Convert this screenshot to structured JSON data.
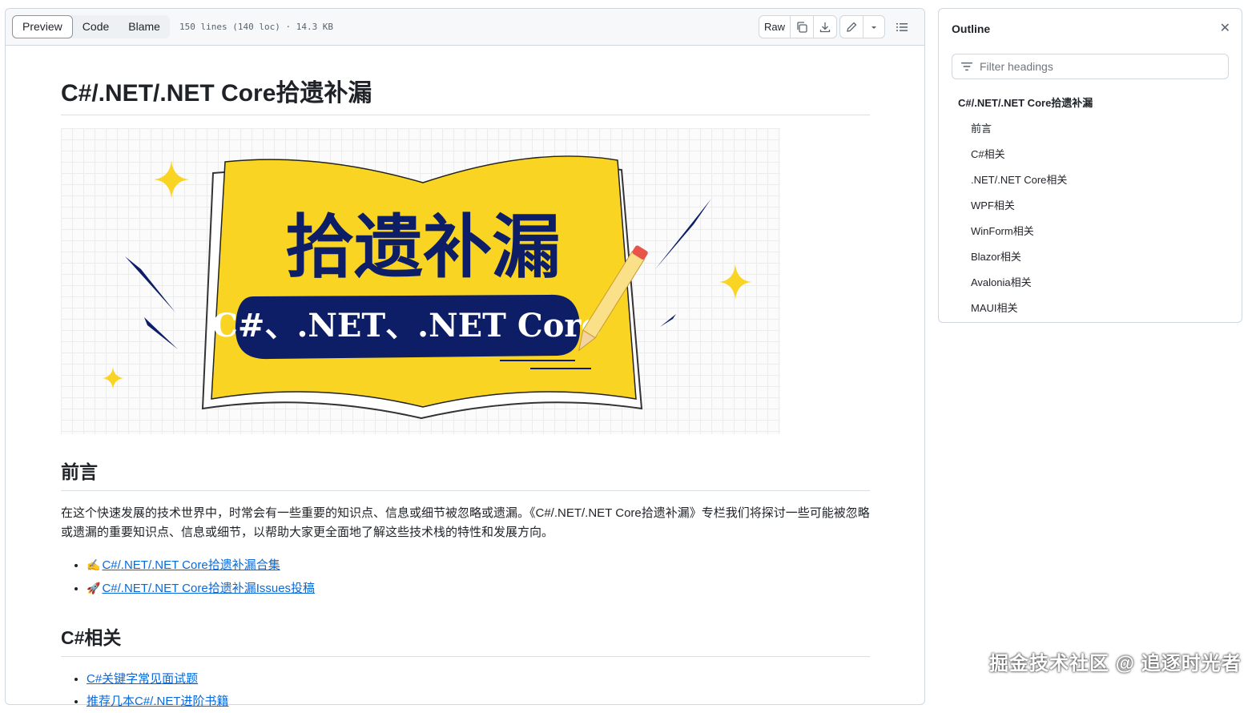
{
  "toolbar": {
    "tabs": [
      "Preview",
      "Code",
      "Blame"
    ],
    "file_info": "150 lines (140 loc) · 14.3 KB",
    "raw_label": "Raw"
  },
  "article": {
    "title": "C#/.NET/.NET Core拾遗补漏",
    "banner": {
      "main_text": "拾遗补漏",
      "sub_text": "C#、.NET、.NET Core"
    },
    "sections": [
      {
        "heading": "前言",
        "paragraph": "在这个快速发展的技术世界中，时常会有一些重要的知识点、信息或细节被忽略或遗漏。《C#/.NET/.NET Core拾遗补漏》专栏我们将探讨一些可能被忽略或遗漏的重要知识点、信息或细节，以帮助大家更全面地了解这些技术栈的特性和发展方向。",
        "links": [
          {
            "emoji": "✍️",
            "text": "C#/.NET/.NET Core拾遗补漏合集"
          },
          {
            "emoji": "🚀",
            "text": "C#/.NET/.NET Core拾遗补漏Issues投稿"
          }
        ]
      },
      {
        "heading": "C#相关",
        "links": [
          {
            "text": "C#关键字常见面试题"
          },
          {
            "text": "推荐几本C#/.NET进阶书籍"
          }
        ]
      }
    ]
  },
  "outline": {
    "title": "Outline",
    "filter_placeholder": "Filter headings",
    "items": [
      {
        "label": "C#/.NET/.NET Core拾遗补漏",
        "level": 1
      },
      {
        "label": "前言",
        "level": 2
      },
      {
        "label": "C#相关",
        "level": 2
      },
      {
        "label": ".NET/.NET Core相关",
        "level": 2
      },
      {
        "label": "WPF相关",
        "level": 2
      },
      {
        "label": "WinForm相关",
        "level": 2
      },
      {
        "label": "Blazor相关",
        "level": 2
      },
      {
        "label": "Avalonia相关",
        "level": 2
      },
      {
        "label": "MAUI相关",
        "level": 2
      }
    ]
  },
  "watermark": "掘金技术社区 @ 追逐时光者",
  "colors": {
    "link": "#0969da",
    "banner_yellow": "#f9d423",
    "banner_navy": "#0d1e66"
  }
}
